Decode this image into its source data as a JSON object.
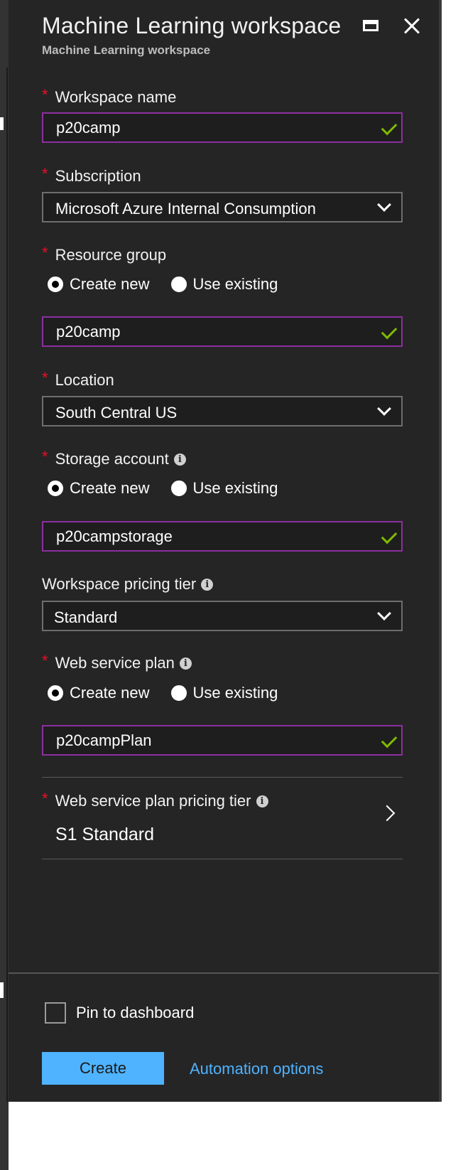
{
  "header": {
    "title": "Machine Learning workspace",
    "subtitle": "Machine Learning workspace",
    "maximize_icon": "maximize-icon",
    "close_icon": "close-icon"
  },
  "required_marker": "*",
  "info_icon_glyph": "i",
  "workspace_name": {
    "label": "Workspace name",
    "value": "p20camp",
    "valid": true
  },
  "subscription": {
    "label": "Subscription",
    "value": "Microsoft Azure Internal Consumption"
  },
  "resource_group": {
    "label": "Resource group",
    "options": [
      "Create new",
      "Use existing"
    ],
    "selected": "Create new",
    "value": "p20camp"
  },
  "location": {
    "label": "Location",
    "value": "South Central US"
  },
  "storage_account": {
    "label": "Storage account",
    "options": [
      "Create new",
      "Use existing"
    ],
    "selected": "Create new",
    "value": "p20campstorage"
  },
  "pricing_tier": {
    "label": "Workspace pricing tier",
    "value": "Standard"
  },
  "web_service_plan": {
    "label": "Web service plan",
    "options": [
      "Create new",
      "Use existing"
    ],
    "selected": "Create new",
    "value": "p20campPlan"
  },
  "web_service_plan_pricing_tier": {
    "label": "Web service plan pricing tier",
    "value": "S1 Standard"
  },
  "footer": {
    "pin_label": "Pin to dashboard",
    "pin_checked": false,
    "create_label": "Create",
    "automation_label": "Automation options"
  },
  "colors": {
    "blade_bg": "#252526",
    "required": "#e81123",
    "valid_border": "#8d2f9e",
    "check": "#7fba00",
    "accent": "#4fb3ff"
  }
}
